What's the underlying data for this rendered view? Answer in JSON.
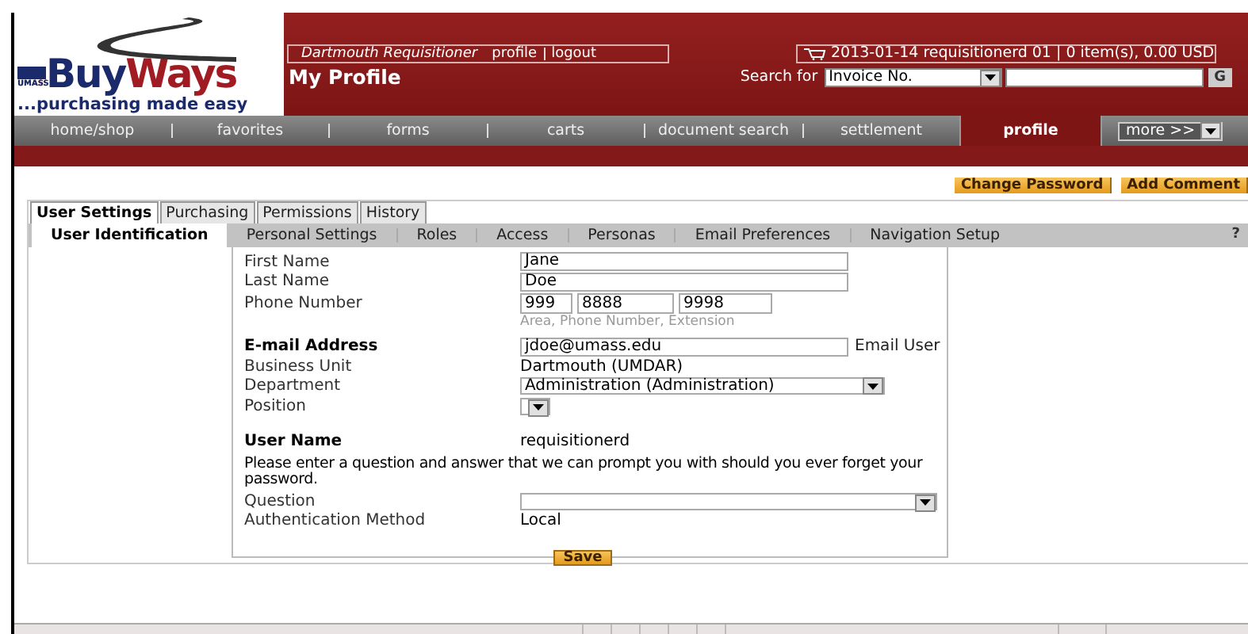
{
  "logo": {
    "badge": "UMASS",
    "first": "Buy",
    "second": "Ways",
    "tagline": "...purchasing made easy"
  },
  "user_bar": {
    "role": "Dartmouth Requisitioner",
    "links": [
      "profile",
      "logout"
    ]
  },
  "cart": "2013-01-14 requisitionerd 01 | 0 item(s), 0.00 USD",
  "page_title": "My Profile",
  "search": {
    "label": "Search for",
    "type": "Invoice No.",
    "go": "G"
  },
  "nav": [
    {
      "label": "home/shop",
      "selected": false
    },
    {
      "label": "favorites",
      "selected": false
    },
    {
      "label": "forms",
      "selected": false
    },
    {
      "label": "carts",
      "selected": false
    },
    {
      "label": "document search",
      "selected": false
    },
    {
      "label": "settlement",
      "selected": false
    },
    {
      "label": "profile",
      "selected": true
    }
  ],
  "more": "more >>",
  "actions": [
    "Change Password",
    "Add Comment"
  ],
  "tabs": [
    {
      "label": "User Settings",
      "selected": true
    },
    {
      "label": "Purchasing",
      "selected": false
    },
    {
      "label": "Permissions",
      "selected": false
    },
    {
      "label": "History",
      "selected": false
    }
  ],
  "subtabs": [
    {
      "label": "User Identification",
      "selected": true
    },
    {
      "label": "Personal Settings",
      "selected": false
    },
    {
      "label": "Roles",
      "selected": false
    },
    {
      "label": "Access",
      "selected": false
    },
    {
      "label": "Personas",
      "selected": false
    },
    {
      "label": "Email Preferences",
      "selected": false
    },
    {
      "label": "Navigation Setup",
      "selected": false
    }
  ],
  "help": "?",
  "fields": [
    {
      "kind": "input",
      "label": "First Name",
      "bold": false,
      "value": "Jane"
    },
    {
      "kind": "input",
      "label": "Last Name",
      "bold": false,
      "value": "Doe"
    },
    {
      "kind": "phone",
      "label": "Phone Number",
      "bold": false,
      "values": [
        "999",
        "8888",
        "9998"
      ],
      "hint": "Area, Phone Number, Extension"
    },
    {
      "kind": "email",
      "label": "E-mail Address",
      "bold": true,
      "value": "jdoe@umass.edu",
      "action": "Email User"
    },
    {
      "kind": "static",
      "label": "Business Unit",
      "bold": false,
      "value": "Dartmouth (UMDAR)"
    },
    {
      "kind": "select",
      "label": "Department",
      "bold": false,
      "value": "Administration (Administration)"
    },
    {
      "kind": "small_select",
      "label": "Position",
      "bold": false
    },
    {
      "kind": "static",
      "label": "User Name",
      "bold": true,
      "value": "requisitionerd"
    },
    {
      "kind": "note",
      "text": "Please enter a question and answer that we can prompt you with should you ever forget your password."
    },
    {
      "kind": "wide_select",
      "label": "Question",
      "bold": false
    },
    {
      "kind": "static",
      "label": "Authentication Method",
      "bold": false,
      "value": "Local"
    }
  ],
  "save": "Save"
}
